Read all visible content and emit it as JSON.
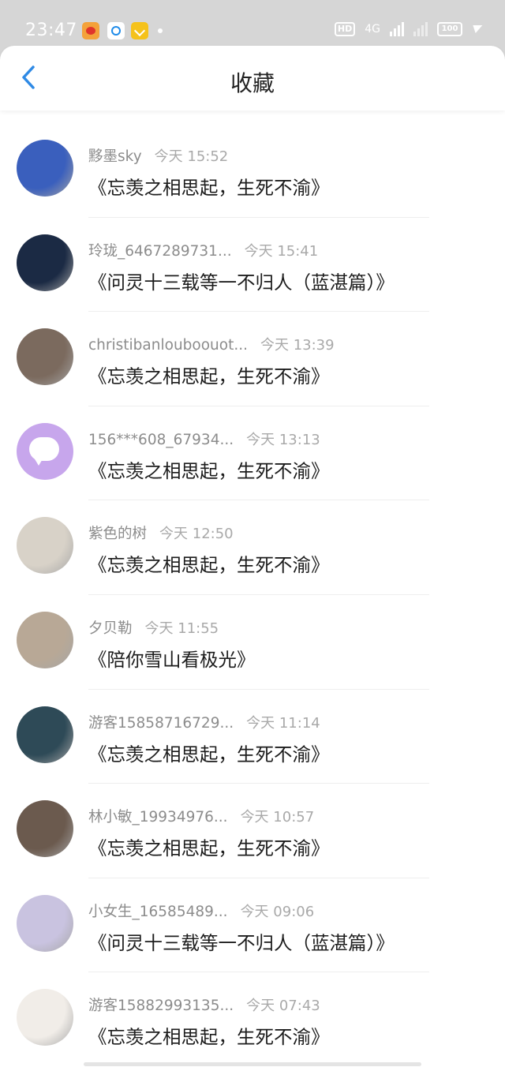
{
  "status_bar": {
    "time": "23:47",
    "hd_label": "HD",
    "network": "4G",
    "battery": "100"
  },
  "header": {
    "title": "收藏",
    "accent_color": "#2f8ae5"
  },
  "items": [
    {
      "name": "黟墨sky",
      "time": "今天 15:52",
      "content": "《忘羡之相思起，生死不渝》",
      "avatar_color": "#3a5fbd"
    },
    {
      "name": "玲珑_6467289731...",
      "time": "今天 15:41",
      "content": "《问灵十三载等一不归人（蓝湛篇）》",
      "avatar_color": "#1b2a44"
    },
    {
      "name": "christibanlouboouot...",
      "time": "今天 13:39",
      "content": "《忘羡之相思起，生死不渝》",
      "avatar_color": "#7b6a5e"
    },
    {
      "name": "156***608_67934...",
      "time": "今天 13:13",
      "content": "《忘羡之相思起，生死不渝》",
      "avatar_color": "#c7a6ec"
    },
    {
      "name": "紫色的树",
      "time": "今天 12:50",
      "content": "《忘羡之相思起，生死不渝》",
      "avatar_color": "#d8d2c8"
    },
    {
      "name": "夕贝勒",
      "time": "今天 11:55",
      "content": "《陪你雪山看极光》",
      "avatar_color": "#b8a896"
    },
    {
      "name": "游客15858716729...",
      "time": "今天 11:14",
      "content": "《忘羡之相思起，生死不渝》",
      "avatar_color": "#2e4a57"
    },
    {
      "name": "林小敏_19934976...",
      "time": "今天 10:57",
      "content": "《忘羡之相思起，生死不渝》",
      "avatar_color": "#6b5a4e"
    },
    {
      "name": "小女生_16585489...",
      "time": "今天 09:06",
      "content": "《问灵十三载等一不归人（蓝湛篇）》",
      "avatar_color": "#c9c3e0"
    },
    {
      "name": "游客15882993135...",
      "time": "今天 07:43",
      "content": "《忘羡之相思起，生死不渝》",
      "avatar_color": "#f1ede8"
    }
  ]
}
